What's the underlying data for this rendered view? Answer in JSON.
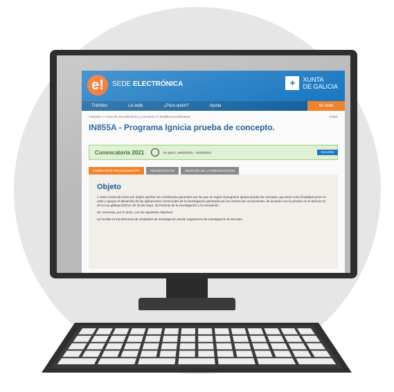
{
  "header": {
    "logo": "e!",
    "title_prefix": "SEDE",
    "title_bold": "ELECTRÓNICA",
    "xunta_line1": "XUNTA",
    "xunta_line2": "DE GALICIA"
  },
  "nav": {
    "items": [
      "Trámites",
      "La sede",
      "¿Para quién?",
      "Ayuda"
    ],
    "mi_sede": "Mi sede"
  },
  "breadcrumb": {
    "text": "Trámites  >>  Guía de procedimientos y servicios  >>  Detalle procedimiento",
    "volver": "Volver"
  },
  "procedure": {
    "title": "IN855A - Programa Ignicia prueba de concepto.",
    "escuchar": "Escuchar"
  },
  "convocatoria": {
    "label": "Convocatoria 2021",
    "plazo": "En plazo: 26/02/2021 - 22/03/2021"
  },
  "tabs": [
    "SOBRE ESTE PROCEDIMIENTO",
    "PRESENTACIÓN",
    "DESPUÉS DE LA PRESENTACIÓN"
  ],
  "content": {
    "heading": "Objeto",
    "para1": "1. Esta resolución tiene por objeto aprobar las condiciones generales por las que se regirá el programa Ignicia prueba de concepto, que tiene como finalidad poner en valor y apoyar el desarrollo de las aplicaciones comerciales de la investigación generada por los centros de conocimiento, de acuerdo con lo previsto en el artículo 31 de la Ley gallega 5/2013, de 30 de mayo, de fomento de la investigación y la innovación.",
    "para2": "Se concretan, por lo tanto, con los siguientes objetivos:",
    "para3": "a) Facilitar la transferencia de resultados de investigación desde organismos de investigación al mercado."
  },
  "colors": {
    "header_blue": "#1a78c2",
    "nav_blue": "#16629e",
    "accent_orange": "#f0822a",
    "convocatoria_green": "#dff0d4"
  }
}
